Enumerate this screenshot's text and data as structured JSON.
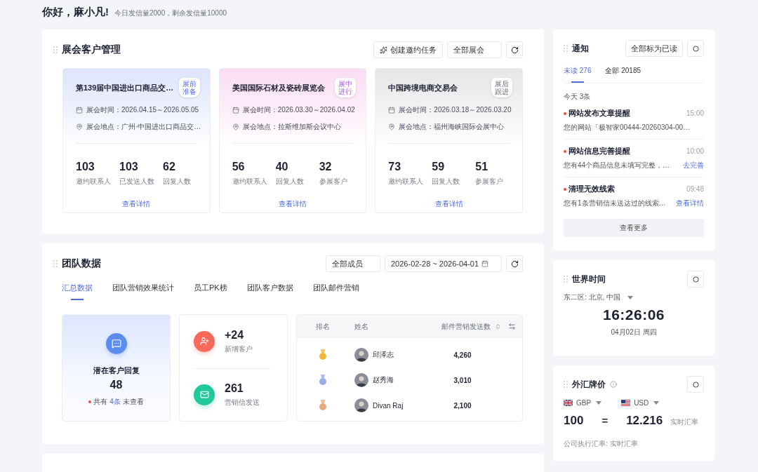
{
  "greeting": {
    "title": "你好，麻小凡!",
    "subtitle": "今日发信量2000，剩余发信量10000"
  },
  "exhibitions": {
    "title": "展会客户管理",
    "create_button": "创建邀约任务",
    "filter": "全部展会",
    "cards": [
      {
        "name": "第139届中国进出口商品交…",
        "badge": "展前准备",
        "color": "#dde4fb",
        "kind": "before",
        "time": "展会时间：2026.04.15～2026.05.05",
        "place": "展会地点：广州·中国进出口商品交…",
        "stats": [
          {
            "value": "103",
            "label": "邀约联系人"
          },
          {
            "value": "103",
            "label": "已发送人数"
          },
          {
            "value": "62",
            "label": "回复人数"
          }
        ],
        "link": "查看详情"
      },
      {
        "name": "美国国际石材及瓷砖展览会",
        "badge": "展中进行",
        "color": "#fbdcf3",
        "kind": "during",
        "time": "展会时间：2026.03.30～2026.04.02",
        "place": "展会地点：拉斯维加斯会议中心",
        "stats": [
          {
            "value": "56",
            "label": "邀约联系人"
          },
          {
            "value": "40",
            "label": "回复人数"
          },
          {
            "value": "32",
            "label": "参展客户"
          }
        ],
        "link": "查看详情"
      },
      {
        "name": "中国跨境电商交易会",
        "badge": "展后跟进",
        "color": "#e6e6e8",
        "kind": "after",
        "time": "展会时间：2026.03.18～2026.03.20",
        "place": "展会地点：福州海峡国际会展中心",
        "stats": [
          {
            "value": "73",
            "label": "邀约联系人"
          },
          {
            "value": "59",
            "label": "回复人数"
          },
          {
            "value": "51",
            "label": "参展客户"
          }
        ],
        "link": "查看详情"
      }
    ]
  },
  "team": {
    "title": "团队数据",
    "member_filter": "全部成员",
    "date_range": "2026-02-28 ~ 2026-04-01",
    "tabs": [
      {
        "label": "汇总数据",
        "selected": true
      },
      {
        "label": "团队营销效果统计",
        "selected": false
      },
      {
        "label": "员工PK榜",
        "selected": false
      },
      {
        "label": "团队客户数据",
        "selected": false
      },
      {
        "label": "团队邮件营销",
        "selected": false
      }
    ],
    "summary": {
      "title": "潜在客户回复",
      "value": "48",
      "note_prefix": "共有",
      "note_count": "4条",
      "note_suffix": "未查看"
    },
    "stats": [
      {
        "kind": "customer",
        "value": "+24",
        "label": "新增客户",
        "color": "#f7695a"
      },
      {
        "kind": "mail",
        "value": "261",
        "label": "营销信发送",
        "color": "#22c79b"
      }
    ],
    "ranking": {
      "columns": [
        "排名",
        "姓名",
        "邮件营销发送数"
      ],
      "rows": [
        {
          "name": "邱泽志",
          "count": "4,260",
          "color": "#f2b53a"
        },
        {
          "name": "赵秀海",
          "count": "3,010",
          "color": "#9aaee6"
        },
        {
          "name": "Divan Raj",
          "count": "2,100",
          "color": "#e9a77c"
        }
      ]
    }
  },
  "notifications": {
    "title": "通知",
    "mark_all": "全部标为已读",
    "tabs": [
      {
        "label": "未读 276",
        "selected": true
      },
      {
        "label": "全部 20185",
        "selected": false
      }
    ],
    "group": "今天 3条",
    "items": [
      {
        "title": "网站发布文章提醒",
        "time": "15:00",
        "body": "您的网站「极智家00444-20260304-00…",
        "unread": true
      },
      {
        "title": "网站信息完善提醒",
        "time": "10:00",
        "body": "您有44个商品信息未填写完整，…",
        "link": "去完善",
        "unread": true
      },
      {
        "title": "清理无效线索",
        "time": "09:48",
        "body": "您有1条营销信未送达过的线索…",
        "link": "查看详情",
        "unread": true
      }
    ],
    "more": "查看更多"
  },
  "world_time": {
    "title": "世界时间",
    "zone": "东二区: 北京, 中国",
    "time": "16:26:06",
    "date": "04月02日 周四"
  },
  "forex": {
    "title": "外汇牌价",
    "from": "GBP",
    "to": "USD",
    "amount": "100",
    "equals": "=",
    "rate": "12.216",
    "rate_note": "实时汇率",
    "footer": "公司执行汇率: 实时汇率"
  }
}
